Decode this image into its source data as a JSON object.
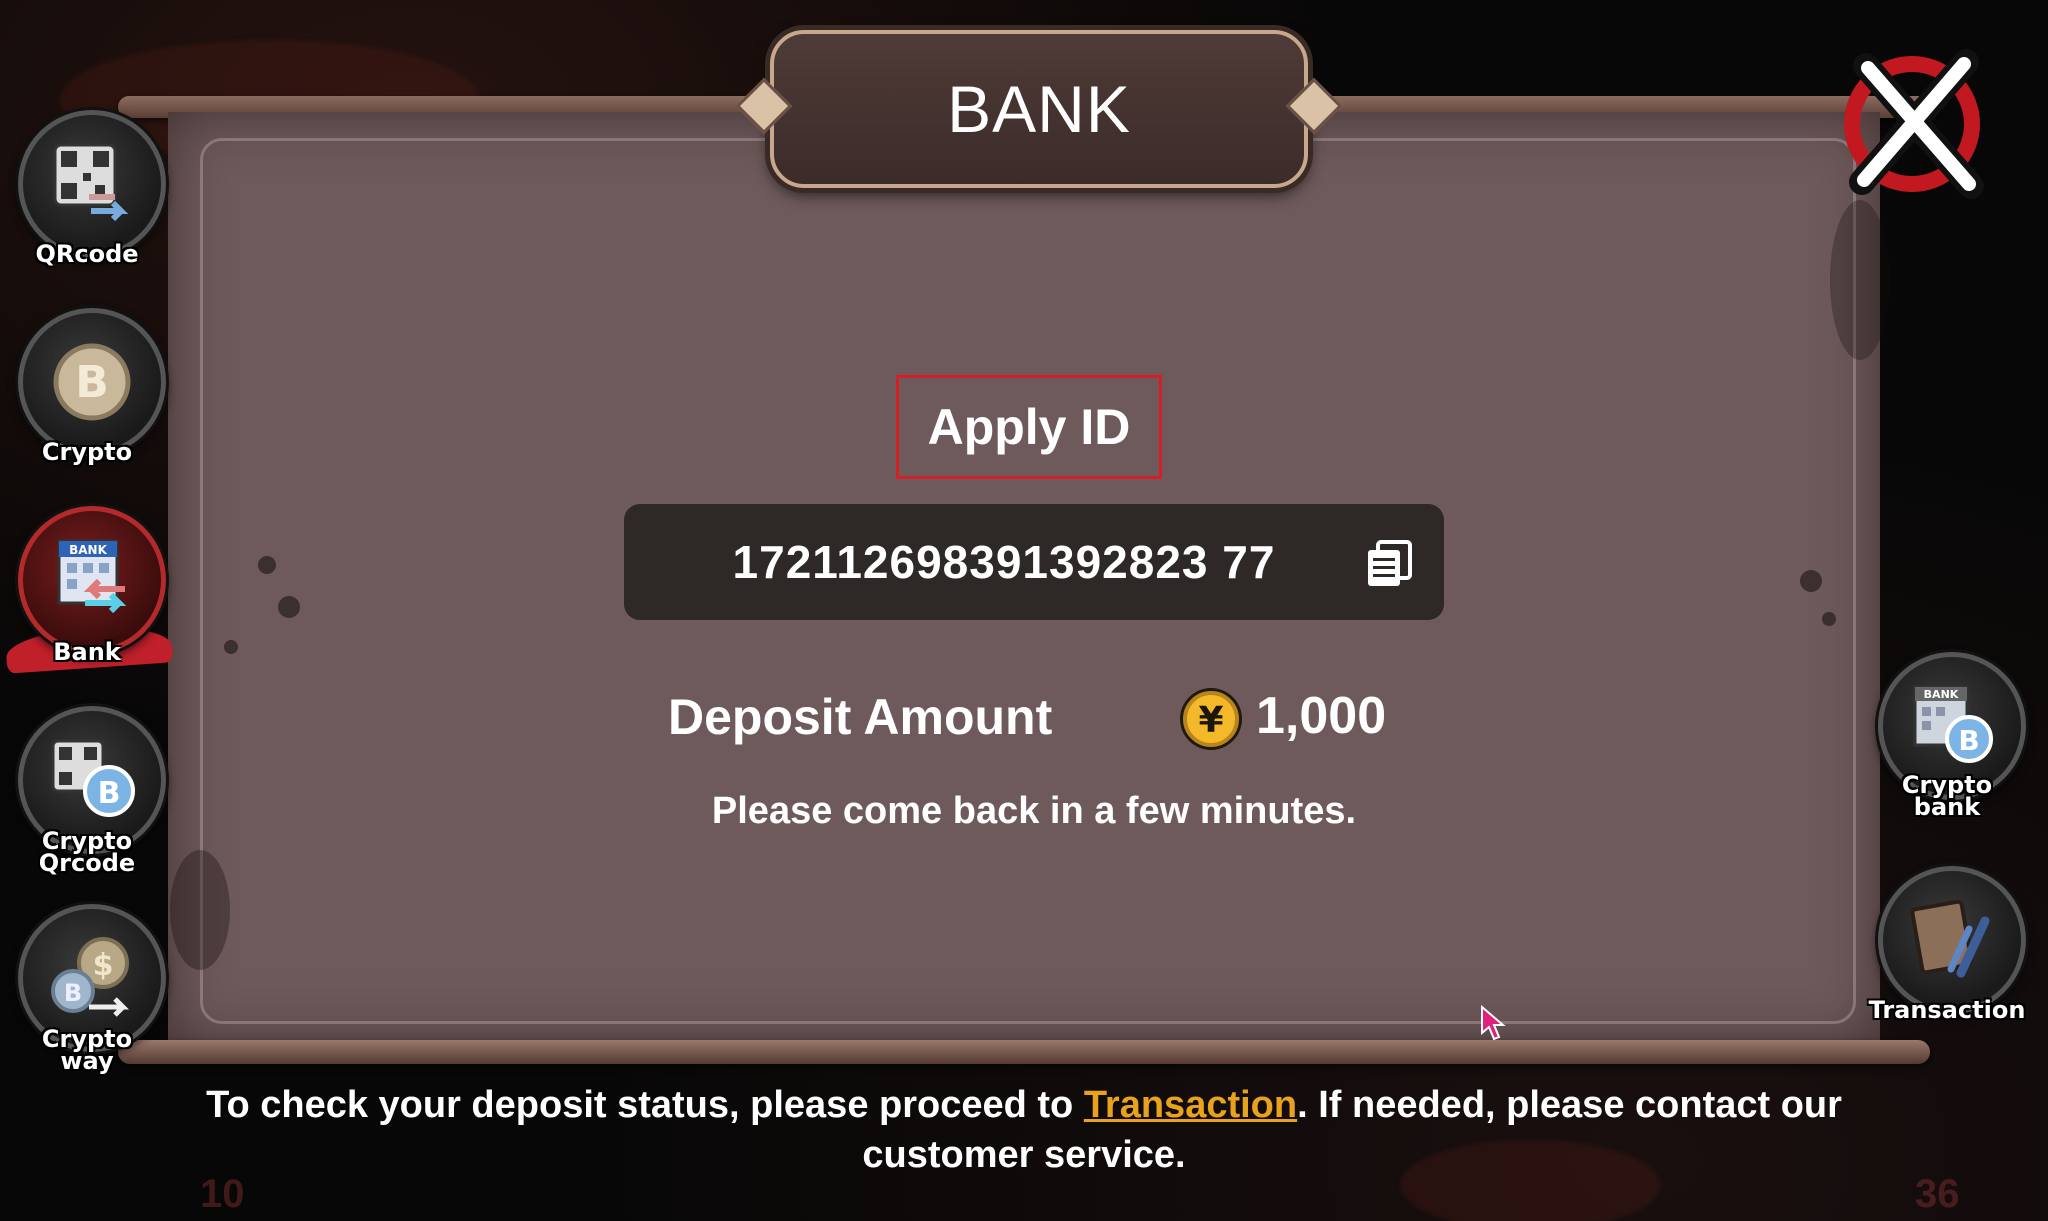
{
  "title": "BANK",
  "sidebar_left": {
    "items": [
      {
        "label": "QRcode",
        "icon": "qrcode-icon",
        "active": false
      },
      {
        "label": "Crypto",
        "icon": "bitcoin-icon",
        "active": false
      },
      {
        "label": "Bank",
        "icon": "bank-icon",
        "active": true
      },
      {
        "label": "Crypto\nQrcode",
        "icon": "crypto-qrcode-icon",
        "active": false
      },
      {
        "label": "Crypto\nway",
        "icon": "crypto-way-icon",
        "active": false
      }
    ]
  },
  "sidebar_right": {
    "items": [
      {
        "label": "Crypto\nbank",
        "icon": "crypto-bank-icon",
        "active": false
      },
      {
        "label": "Transaction",
        "icon": "transaction-book-icon",
        "active": false
      }
    ]
  },
  "apply_id": {
    "label": "Apply ID",
    "value": "172112698391392823 77",
    "copy_icon": "copy-icon"
  },
  "deposit": {
    "label": "Deposit Amount",
    "currency_icon": "yen-coin-icon",
    "amount": "1,000"
  },
  "notice": "Please come back in a few minutes.",
  "footer": {
    "text_before": "To check your deposit status, please proceed to ",
    "link": "Transaction",
    "text_after": ". If needed, please contact our customer service."
  },
  "background_badges": [
    "10",
    "36"
  ],
  "colors": {
    "panel": "#6e5a5b",
    "active_nav": "#c0202a",
    "highlight_border": "#d41f26",
    "link": "#e8a31d"
  }
}
